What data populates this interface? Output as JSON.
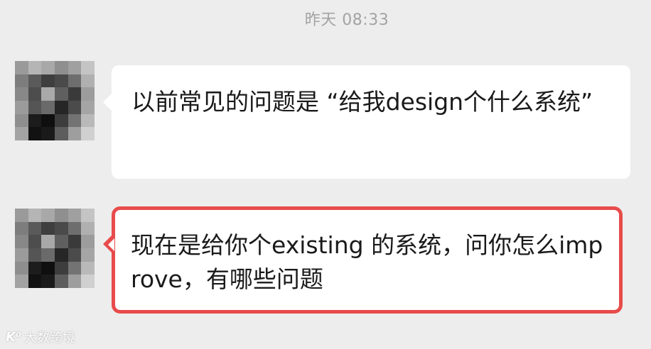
{
  "header": {
    "timestamp": "昨天 08:33"
  },
  "messages": [
    {
      "sender": "contact",
      "text": "以前常见的问题是 “给我design个什么系统”",
      "highlighted": false
    },
    {
      "sender": "contact",
      "text": "现在是给你个existing 的系统，问你怎么improve，有哪些问题",
      "highlighted": true
    }
  ],
  "watermark": {
    "logo": "K⁰",
    "text": "大数跨境"
  },
  "colors": {
    "background": "#ededed",
    "bubble": "#ffffff",
    "highlight_border": "#e84b4b",
    "timestamp": "#a3a3a3",
    "text": "#1a1a1a"
  },
  "avatar_pixels": [
    [
      "#9a9a9a",
      "#b5b5b5",
      "#a8a8a8",
      "#8f8f8f",
      "#a0a0a0",
      "#c4c4c4"
    ],
    [
      "#7d7d7d",
      "#5a5a5a",
      "#3e3e3e",
      "#4a4a4a",
      "#6e6e6e",
      "#b0b0b0"
    ],
    [
      "#888888",
      "#4d4d4d",
      "#a9a9a9",
      "#5f5f5f",
      "#3a3a3a",
      "#9c9c9c"
    ],
    [
      "#9b9b9b",
      "#555555",
      "#6a6a6a",
      "#262626",
      "#4b4b4b",
      "#a5a5a5"
    ],
    [
      "#8e8e8e",
      "#1c1c1c",
      "#0f0f0f",
      "#3d3d3d",
      "#737373",
      "#b9b9b9"
    ],
    [
      "#a3a3a3",
      "#121212",
      "#1a1a1a",
      "#5d5d5d",
      "#9e9e9e",
      "#d0d0d0"
    ]
  ]
}
